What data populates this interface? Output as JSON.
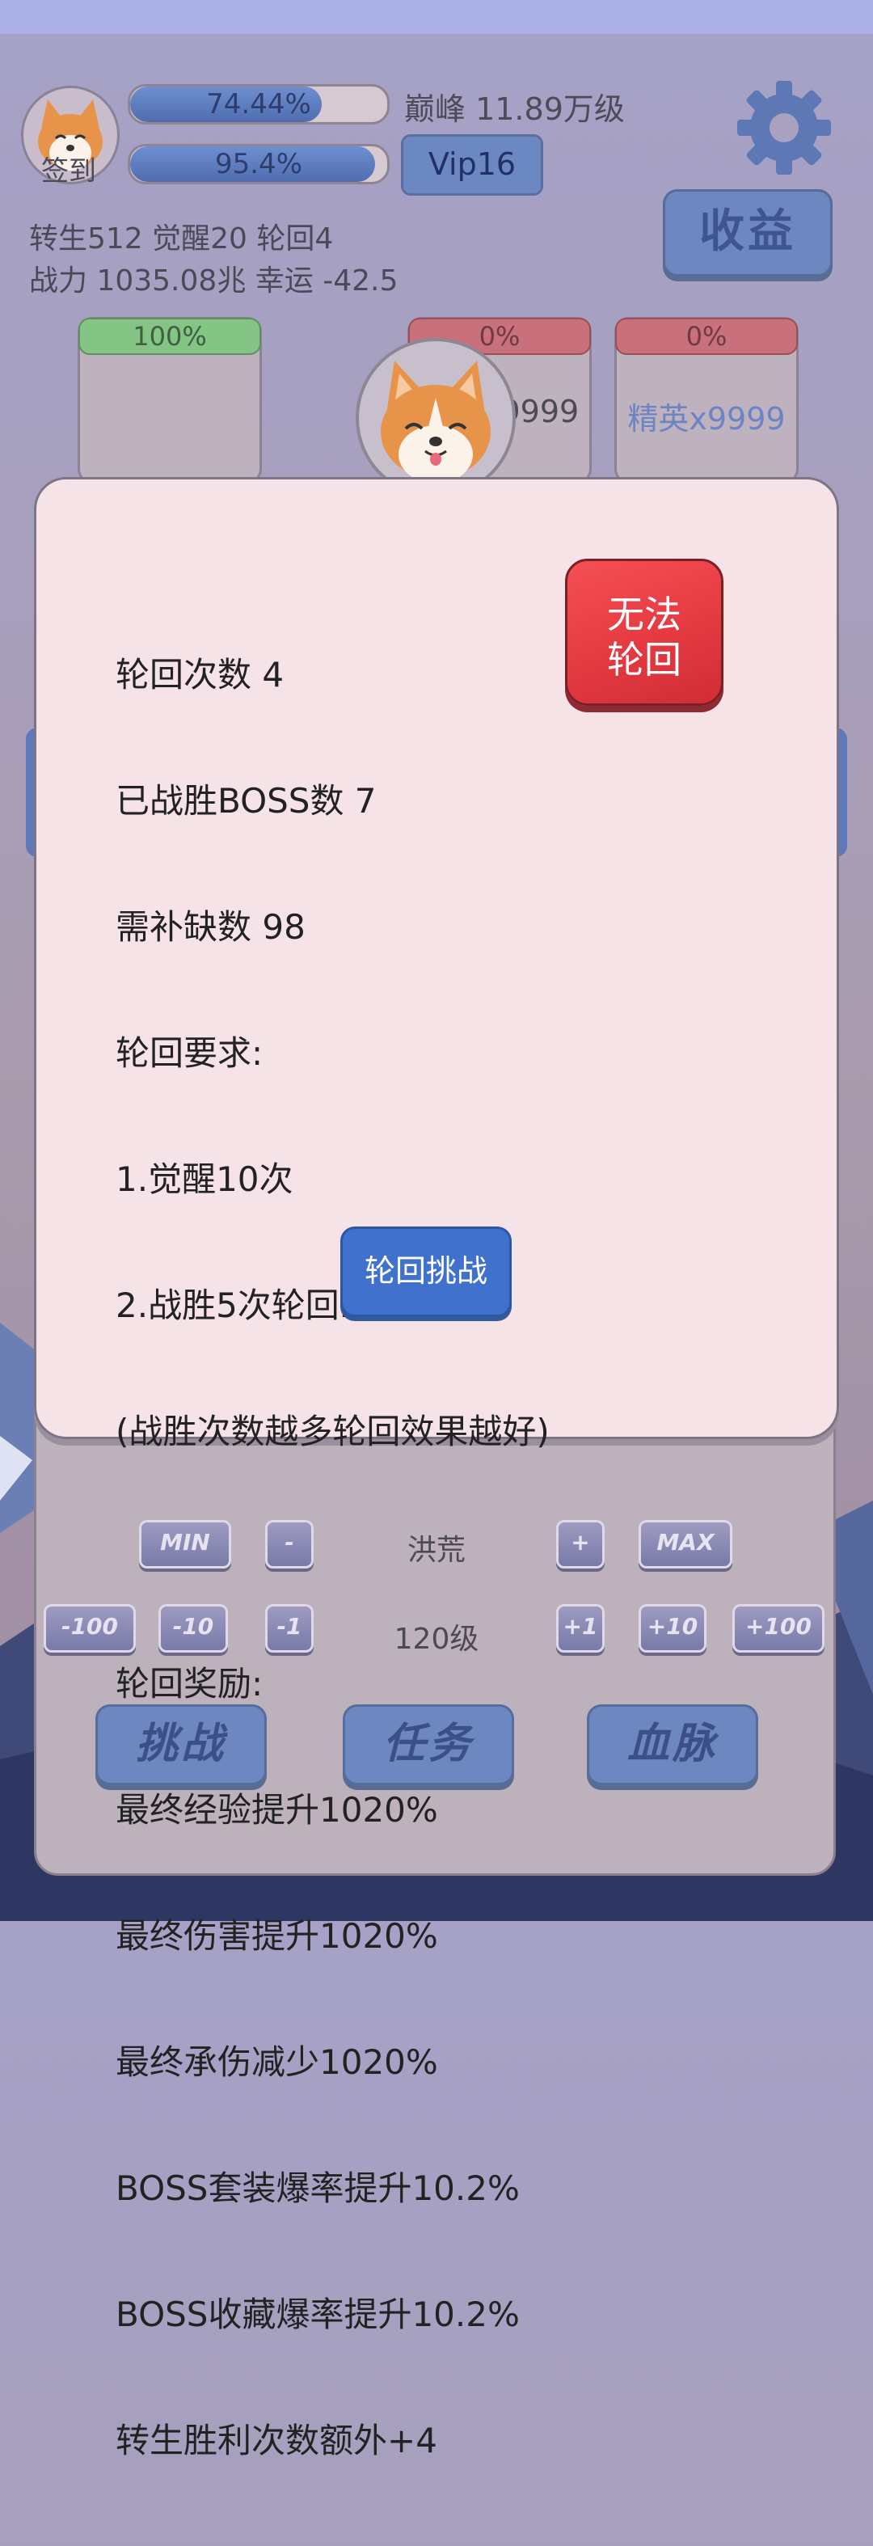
{
  "header": {
    "signin_label": "签到",
    "exp_bar": {
      "text": "74.44%",
      "fill_percent": 74.44
    },
    "second_bar": {
      "text": "95.4%",
      "fill_percent": 95.4
    },
    "peak_label": "巅峰 11.89万级",
    "vip_label": "Vip16",
    "income_label": "收益",
    "stats_line1": "转生512 觉醒20 轮回4",
    "stats_line2": "战力 1035.08兆  幸运 -42.5"
  },
  "cards": [
    {
      "pct": "100%",
      "label": "",
      "status": "green"
    },
    {
      "pct": "0%",
      "label": "x9999",
      "status": "red"
    },
    {
      "pct": "0%",
      "label": "精英x9999",
      "status": "red"
    }
  ],
  "dialog": {
    "lines": [
      "轮回次数 4",
      "已战胜BOSS数 7",
      "需补缺数 98",
      "轮回要求:",
      "1.觉醒10次",
      "2.战胜5次轮回BOSS",
      "(战胜次数越多轮回效果越好)",
      "",
      "轮回奖励:",
      "最终经验提升1020%",
      "最终伤害提升1020%",
      "最终承伤减少1020%",
      "BOSS套装爆率提升10.2%",
      "BOSS收藏爆率提升10.2%",
      "转生胜利次数额外+4"
    ],
    "fail_button_line1": "无法",
    "fail_button_line2": "轮回",
    "challenge_button": "轮回挑战"
  },
  "controls": {
    "row1": {
      "min": "MIN",
      "minus": "-",
      "value": "洪荒",
      "plus": "+",
      "max": "MAX"
    },
    "row2": {
      "m100": "-100",
      "m10": "-10",
      "m1": "-1",
      "value": "120级",
      "p1": "+1",
      "p10": "+10",
      "p100": "+100"
    }
  },
  "bottom_buttons": {
    "challenge": "挑战",
    "task": "任务",
    "bloodline": "血脉"
  },
  "colors": {
    "accent_blue": "#6d87c1",
    "fail_red": "#e53a42",
    "dialog_bg": "#f5e3e8"
  }
}
